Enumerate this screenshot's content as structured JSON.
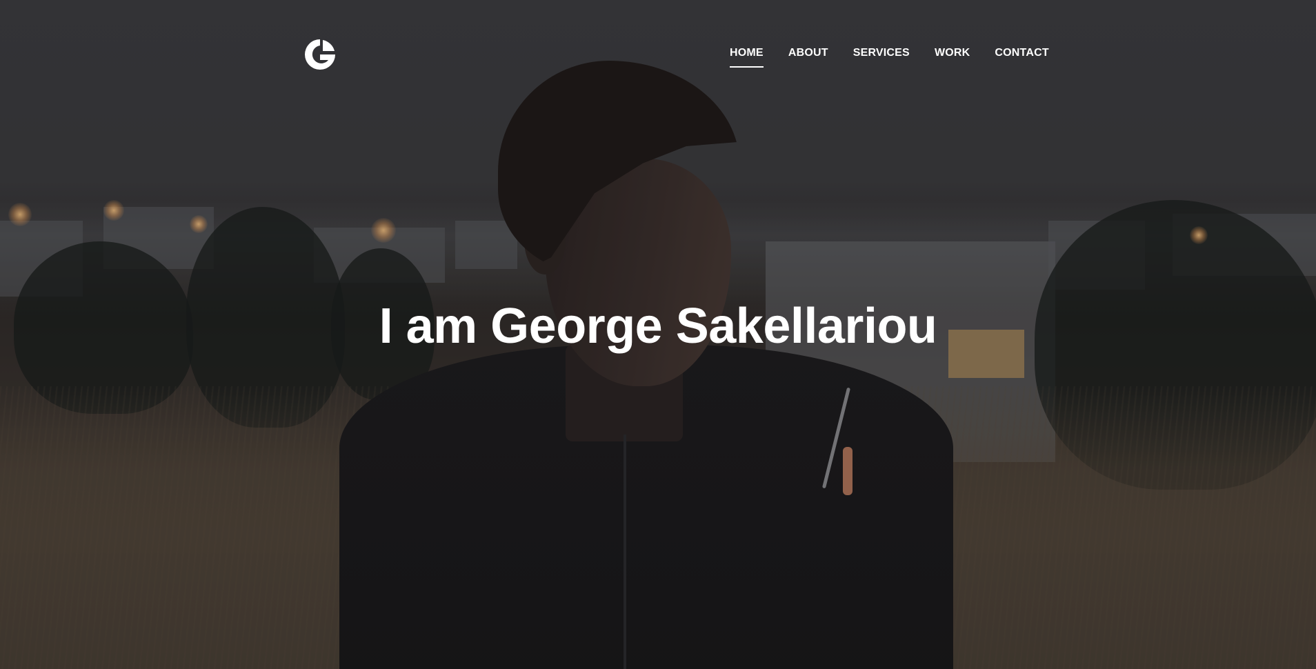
{
  "header": {
    "logo_icon": "g-circle-logo-icon",
    "nav": [
      {
        "label": "HOME",
        "active": true
      },
      {
        "label": "ABOUT",
        "active": false
      },
      {
        "label": "SERVICES",
        "active": false
      },
      {
        "label": "WORK",
        "active": false
      },
      {
        "label": "CONTACT",
        "active": false
      }
    ]
  },
  "hero": {
    "headline": "I am George Sakellariou"
  },
  "colors": {
    "text": "#ffffff",
    "overlay": "#1a1a1c"
  }
}
